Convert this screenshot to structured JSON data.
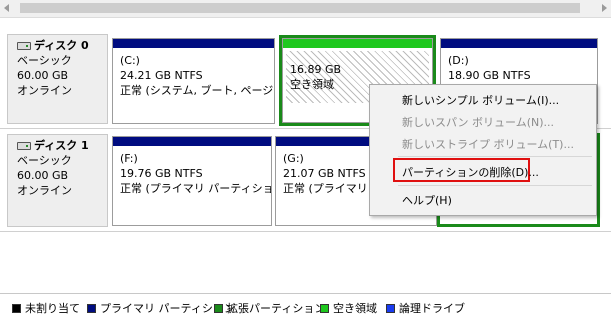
{
  "disks": [
    {
      "name": "ディスク 0",
      "type": "ベーシック",
      "size": "60.00 GB",
      "status": "オンライン",
      "partitions": [
        {
          "drive": "(C:)",
          "size": "24.21 GB NTFS",
          "status": "正常 (システム, ブート, ページ ファ"
        },
        {
          "drive": "",
          "size": "16.89 GB",
          "status": "空き領域"
        },
        {
          "drive": "(D:)",
          "size": "18.90 GB NTFS",
          "status": ""
        }
      ]
    },
    {
      "name": "ディスク 1",
      "type": "ベーシック",
      "size": "60.00 GB",
      "status": "オンライン",
      "partitions": [
        {
          "drive": "(F:)",
          "size": "19.76 GB NTFS",
          "status": "正常 (プライマリ パーティション)"
        },
        {
          "drive": "(G:)",
          "size": "21.07 GB NTFS",
          "status": "正常 (プライマリ パーティシ"
        },
        {
          "drive": "",
          "size": "",
          "status": ""
        }
      ]
    }
  ],
  "context_menu": {
    "items": [
      {
        "label": "新しいシンプル ボリューム(I)...",
        "enabled": true
      },
      {
        "label": "新しいスパン ボリューム(N)...",
        "enabled": false
      },
      {
        "label": "新しいストライプ ボリューム(T)...",
        "enabled": false
      },
      {
        "label": "パーティションの削除(D)...",
        "enabled": true,
        "highlighted": true
      },
      {
        "label": "ヘルプ(H)",
        "enabled": true
      }
    ]
  },
  "legend": [
    {
      "label": "未割り当て",
      "color": "#000000"
    },
    {
      "label": "プライマリ パーティション",
      "color": "#000c80"
    },
    {
      "label": "拡張パーティション",
      "color": "#1a8a1a"
    },
    {
      "label": "空き領域",
      "color": "#1ec81e"
    },
    {
      "label": "論理ドライブ",
      "color": "#1a3cf0"
    }
  ],
  "colors": {
    "primary": "#000c80",
    "free": "#1ec81e",
    "extended": "#1a8a1a",
    "highlight_box": "#e01010"
  }
}
